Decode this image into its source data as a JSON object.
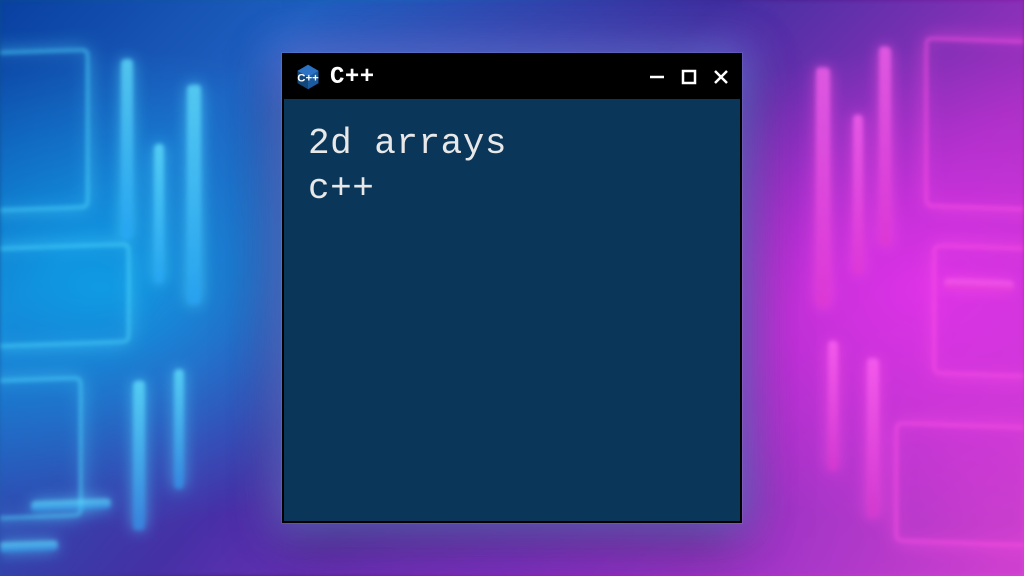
{
  "window": {
    "title": "C++",
    "icon": "cpp-logo-icon"
  },
  "content": {
    "line1": "2d arrays",
    "line2": "c++"
  },
  "colors": {
    "window_bg": "#0a3759",
    "titlebar_bg": "#000000",
    "text": "#e8e8e8",
    "neon_cyan": "#50dcff",
    "neon_magenta": "#ff50e6"
  }
}
